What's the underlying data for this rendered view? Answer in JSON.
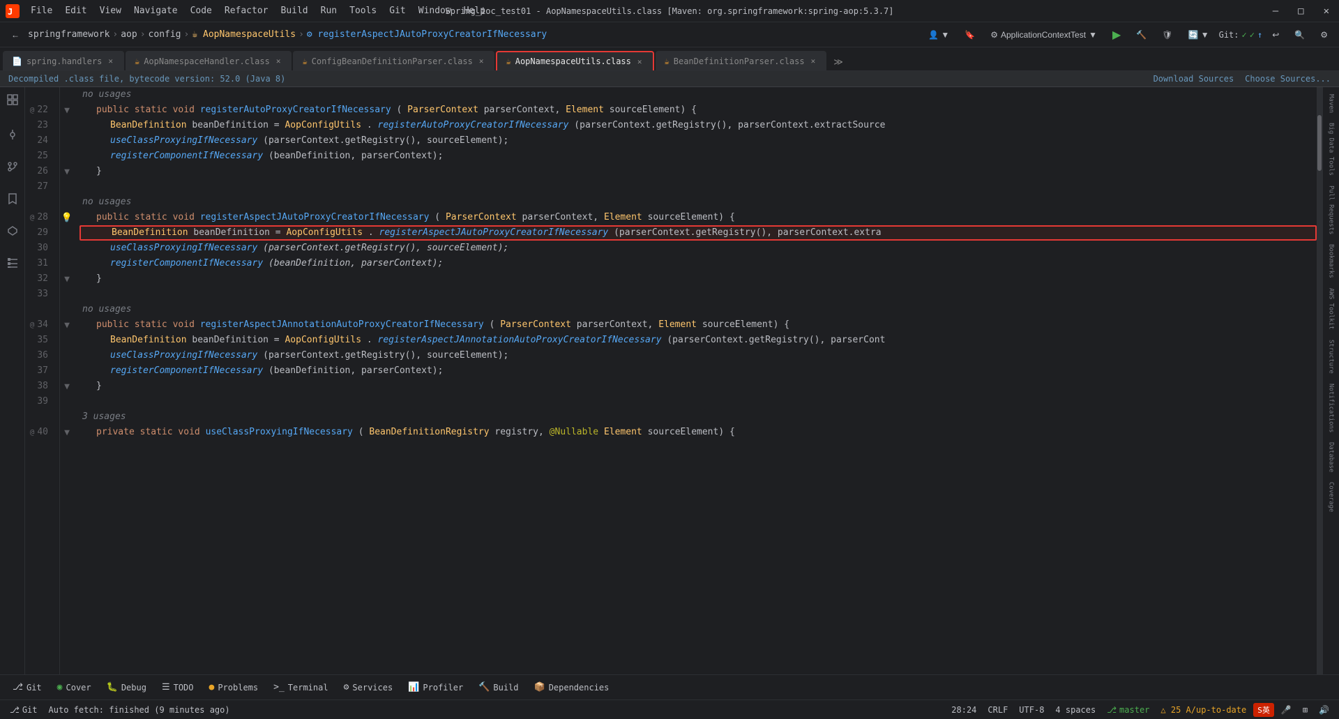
{
  "window": {
    "title": "Spring_ioc_test01 - AopNamespaceUtils.class [Maven: org.springframework:spring-aop:5.3.7]"
  },
  "menu": {
    "items": [
      "File",
      "Edit",
      "View",
      "Navigate",
      "Code",
      "Refactor",
      "Build",
      "Run",
      "Tools",
      "Git",
      "Window",
      "Help"
    ]
  },
  "breadcrumb": {
    "parts": [
      "springframework",
      "aop",
      "config",
      "AopNamespaceUtils",
      "registerAspectJAutoProxyCreatorIfNecessary"
    ]
  },
  "toolbar": {
    "run_config": "ApplicationContextTest",
    "git_label": "Git:"
  },
  "tabs": [
    {
      "label": "spring.handlers",
      "icon": "📄",
      "active": false
    },
    {
      "label": "AopNamespaceHandler.class",
      "icon": "☕",
      "active": false
    },
    {
      "label": "ConfigBeanDefinitionParser.class",
      "icon": "☕",
      "active": false
    },
    {
      "label": "AopNamespaceUtils.class",
      "icon": "☕",
      "active": true,
      "highlighted": true
    },
    {
      "label": "BeanDefinitionParser.class",
      "icon": "☕",
      "active": false
    }
  ],
  "info_bar": {
    "message": "Decompiled .class file, bytecode version: 52.0 (Java 8)",
    "download_sources": "Download Sources",
    "choose_sources": "Choose Sources..."
  },
  "code": {
    "lines": [
      {
        "num": "",
        "content": "no usages",
        "type": "comment"
      },
      {
        "num": "22",
        "indent": 1,
        "content": "public static void registerAutoProxyCreatorIfNecessary(ParserContext parserContext, Element sourceElement) {",
        "annotations": [
          "@"
        ]
      },
      {
        "num": "23",
        "indent": 2,
        "content": "BeanDefinition beanDefinition = AopConfigUtils.registerAutoProxyCreatorIfNecessary(parserContext.getRegistry(), parserContext.extractSource"
      },
      {
        "num": "24",
        "indent": 2,
        "content": "useClassProxyingIfNecessary(parserContext.getRegistry(), sourceElement);"
      },
      {
        "num": "25",
        "indent": 2,
        "content": "registerComponentIfNecessary(beanDefinition, parserContext);"
      },
      {
        "num": "26",
        "indent": 1,
        "content": "}"
      },
      {
        "num": "27",
        "content": ""
      },
      {
        "num": "",
        "content": "no usages",
        "type": "comment"
      },
      {
        "num": "28",
        "indent": 1,
        "content": "public static void registerAspectJAutoProxyCreatorIfNecessary(ParserContext parserContext, Element sourceElement) {",
        "annotations": [
          "@"
        ],
        "bulb": true,
        "highlighted_start": true
      },
      {
        "num": "29",
        "indent": 2,
        "content": "BeanDefinition beanDefinition = AopConfigUtils.registerAspectJAutoProxyCreatorIfNecessary(parserContext.getRegistry(), parserContext.extra",
        "highlighted": true
      },
      {
        "num": "30",
        "indent": 2,
        "content": "useClassProxyingIfNecessary(parserContext.getRegistry(), sourceElement);",
        "italic": true
      },
      {
        "num": "31",
        "indent": 2,
        "content": "registerComponentIfNecessary(beanDefinition, parserContext);",
        "italic": true
      },
      {
        "num": "32",
        "indent": 1,
        "content": "}"
      },
      {
        "num": "33",
        "content": ""
      },
      {
        "num": "",
        "content": "no usages",
        "type": "comment"
      },
      {
        "num": "34",
        "indent": 1,
        "content": "public static void registerAspectJAnnotationAutoProxyCreatorIfNecessary(ParserContext parserContext, Element sourceElement) {",
        "annotations": [
          "@"
        ]
      },
      {
        "num": "35",
        "indent": 2,
        "content": "BeanDefinition beanDefinition = AopConfigUtils.registerAspectJAnnotationAutoProxyCreatorIfNecessary(parserContext.getRegistry(), parserCont"
      },
      {
        "num": "36",
        "indent": 2,
        "content": "useClassProxyingIfNecessary(parserContext.getRegistry(), sourceElement);"
      },
      {
        "num": "37",
        "indent": 2,
        "content": "registerComponentIfNecessary(beanDefinition, parserContext);"
      },
      {
        "num": "38",
        "indent": 1,
        "content": "}"
      },
      {
        "num": "39",
        "content": ""
      },
      {
        "num": "",
        "content": "3 usages",
        "type": "comment"
      },
      {
        "num": "40",
        "indent": 1,
        "content": "private static void useClassProxyingIfNecessary(BeanDefinitionRegistry registry, @Nullable Element sourceElement) {",
        "annotations": [
          "@"
        ]
      }
    ]
  },
  "bottom_tabs": [
    {
      "label": "Git",
      "icon": "⎇"
    },
    {
      "label": "Cover",
      "icon": "◉"
    },
    {
      "label": "Debug",
      "icon": "🐛"
    },
    {
      "label": "TODO",
      "icon": "☰"
    },
    {
      "label": "Problems",
      "icon": "●",
      "dot_color": "orange"
    },
    {
      "label": "Terminal",
      "icon": ">_"
    },
    {
      "label": "Services",
      "icon": "⚙"
    },
    {
      "label": "Profiler",
      "icon": "📊"
    },
    {
      "label": "Build",
      "icon": "🔨"
    },
    {
      "label": "Dependencies",
      "icon": "📦"
    }
  ],
  "status_bar": {
    "auto_fetch": "Auto fetch: finished (9 minutes ago)",
    "position": "28:24",
    "line_ending": "CRLF",
    "encoding": "UTF-8",
    "indent": "4 spaces",
    "git_branch": "master",
    "warnings": "△ 25 A/up-to-date"
  },
  "right_sidebar_labels": [
    "Maven",
    "Big Data Tools",
    "Pull Requests",
    "Bookmarks",
    "AWS Toolkit",
    "Structure",
    "Notifications",
    "Database",
    "Coverage"
  ],
  "left_sidebar_labels": [
    "Project",
    "Commit",
    "Pull Requests",
    "Bookmarks",
    "AWS Toolkit",
    "Structure"
  ]
}
